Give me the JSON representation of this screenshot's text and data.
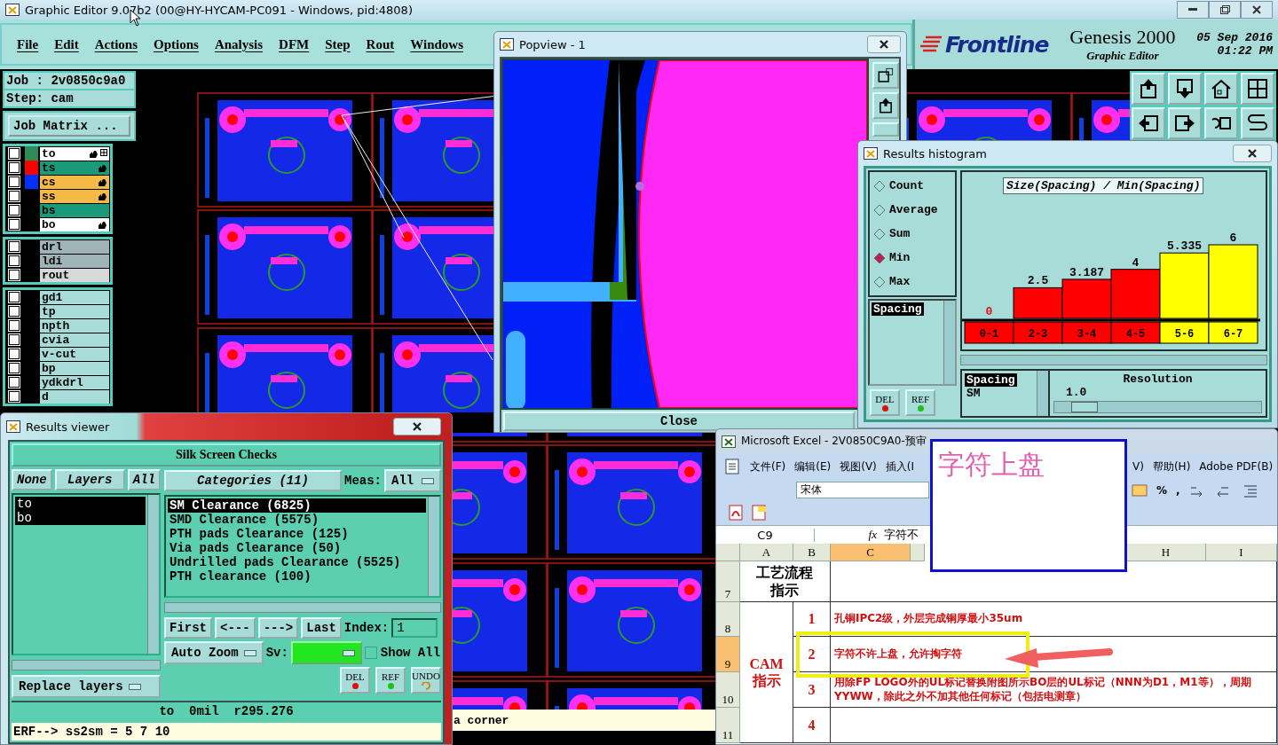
{
  "main_window": {
    "title": "Graphic Editor 9.07b2 (00@HY-HYCAM-PC091 - Windows, pid:4808)",
    "menu": [
      "File",
      "Edit",
      "Actions",
      "Options",
      "Analysis",
      "DFM",
      "Step",
      "Rout",
      "Windows"
    ],
    "brand": {
      "logo": "Frontline",
      "product": "Genesis 2000",
      "subtitle": "Graphic Editor",
      "date": "05 Sep 2016",
      "time": "01:22 PM"
    },
    "job": "Job : 2v0850c9a0",
    "step": "Step: cam",
    "job_matrix_button": "Job Matrix ...",
    "layer_groups": [
      [
        {
          "name": "to",
          "swatch": {
            "color": "#2e8b57"
          },
          "color": "#ffffff",
          "checked": false,
          "hand": true,
          "work_layer": true
        },
        {
          "name": "ts",
          "swatch": {
            "color": "#ff0000"
          },
          "color": "#1a9a78",
          "checked": false,
          "hand": true,
          "work_layer": false
        },
        {
          "name": "cs",
          "swatch": {
            "color": "#0030ff"
          },
          "color": "#f5b946",
          "checked": false,
          "hand": true,
          "work_layer": false
        },
        {
          "name": "ss",
          "color": "#f5b946",
          "checked": false,
          "hand": true,
          "work_layer": false
        },
        {
          "name": "bs",
          "color": "#1a9a78",
          "checked": false,
          "hand": false,
          "work_layer": false
        },
        {
          "name": "bo",
          "color": "#ffffff",
          "checked": false,
          "hand": true,
          "work_layer": false
        }
      ],
      [
        {
          "name": "drl",
          "color": "#9fb4b8",
          "checked": false,
          "hand": false,
          "work_layer": false
        },
        {
          "name": "ldi",
          "color": "#9fb4b8",
          "checked": false,
          "hand": false,
          "work_layer": false
        },
        {
          "name": "rout",
          "color": "#d8d8d8",
          "checked": false,
          "hand": false,
          "work_layer": false
        }
      ],
      [
        {
          "name": "gd1",
          "color": "#a8dcd8",
          "checked": false,
          "hand": false,
          "work_layer": false
        },
        {
          "name": "tp",
          "color": "#a8dcd8",
          "checked": false,
          "hand": false,
          "work_layer": false
        },
        {
          "name": "npth",
          "color": "#a8dcd8",
          "checked": false,
          "hand": false,
          "work_layer": false
        },
        {
          "name": "cvia",
          "color": "#a8dcd8",
          "checked": false,
          "hand": false,
          "work_layer": false
        },
        {
          "name": "v-cut",
          "color": "#a8dcd8",
          "checked": false,
          "hand": false,
          "work_layer": false
        },
        {
          "name": "bp",
          "color": "#a8dcd8",
          "checked": false,
          "hand": false,
          "work_layer": false
        },
        {
          "name": "ydkdrl",
          "color": "#a8dcd8",
          "checked": false,
          "hand": false,
          "work_layer": false
        },
        {
          "name": "d",
          "color": "#a8dcd8",
          "checked": false,
          "hand": false,
          "work_layer": false
        }
      ]
    ],
    "status_hint": "a corner"
  },
  "popview": {
    "title": "Popview - 1",
    "close_button": "Close"
  },
  "results_histogram": {
    "title": "Results histogram",
    "measures": [
      {
        "label": "Count",
        "selected": false
      },
      {
        "label": "Average",
        "selected": false
      },
      {
        "label": "Sum",
        "selected": false
      },
      {
        "label": "Min",
        "selected": true
      },
      {
        "label": "Max",
        "selected": false
      }
    ],
    "attributes": [
      {
        "label": "Spacing",
        "selected": true
      }
    ],
    "buttons": [
      "DEL",
      "REF"
    ],
    "chart_data": {
      "type": "bar",
      "title": "Size(Spacing) / Min(Spacing)",
      "categories": [
        "0-1",
        "2-3",
        "3-4",
        "4-5",
        "5-6",
        "6-7"
      ],
      "values": [
        0,
        2.5,
        3.187,
        4,
        5.335,
        6
      ],
      "data_labels": true
    },
    "bins": [
      {
        "color": "#ff0000"
      },
      {
        "color": "#ff0000"
      },
      {
        "color": "#ff0000"
      },
      {
        "color": "#ff0000"
      },
      {
        "color": "#ffff00"
      },
      {
        "color": "#ffff00"
      }
    ],
    "sources": [
      {
        "label": "Spacing",
        "selected": true
      },
      {
        "label": "SM",
        "selected": false
      }
    ],
    "resolution": {
      "label": "Resolution",
      "value": "1.0",
      "level": 0.08
    }
  },
  "results_viewer": {
    "title": "Results viewer",
    "header": "Silk Screen Checks",
    "layer_buttons": [
      "None",
      "Layers",
      "All"
    ],
    "layers": [
      {
        "label": "to",
        "selected": true
      },
      {
        "label": "bo",
        "selected": true
      }
    ],
    "categories_button": "Categories (11)",
    "meas_label": "Meas:",
    "meas_value": "All",
    "categories": [
      {
        "label": "SM Clearance (6825)",
        "selected": true
      },
      {
        "label": "SMD Clearance (5575)",
        "selected": false
      },
      {
        "label": "PTH pads Clearance (125)",
        "selected": false
      },
      {
        "label": "Via pads Clearance (50)",
        "selected": false
      },
      {
        "label": "Undrilled pads Clearance (5525)",
        "selected": false
      },
      {
        "label": "PTH clearance (100)",
        "selected": false
      }
    ],
    "nav_buttons": [
      "First",
      "<---",
      "--->",
      "Last"
    ],
    "index_label": "Index:",
    "index_value": "1",
    "zoom_mode": "Auto Zoom",
    "sv_label": "Sv:",
    "sv": {
      "color": "#22e622"
    },
    "show_all": {
      "label": "Show All",
      "checked": false
    },
    "replace_mode": "Replace layers",
    "action_buttons": [
      "DEL",
      "REF",
      "UNDO"
    ],
    "status": "to  0mil  r295.276",
    "command": "ERF--> ss2sm = 5 7 10"
  },
  "excel": {
    "title": "Microsoft Excel - 2V0850C9A0-预审",
    "menu": [
      "文件(F)",
      "编辑(E)",
      "视图(V)",
      "插入(I",
      "V)",
      "帮助(H)",
      "Adobe PDF(B)"
    ],
    "font": "宋体",
    "toolbar_texts": [
      "%",
      ","
    ],
    "name_box": "C9",
    "fx": "fx",
    "formula": "字符不",
    "columns": [
      {
        "label": "A",
        "selected": false
      },
      {
        "label": "B",
        "selected": false
      },
      {
        "label": "C",
        "selected": true
      },
      {
        "label": "H",
        "selected": false
      },
      {
        "label": "I",
        "selected": false
      }
    ],
    "rows": [
      {
        "label": "7",
        "selected": false
      },
      {
        "label": "8",
        "selected": false
      },
      {
        "label": "9",
        "selected": true
      },
      {
        "label": "10",
        "selected": false
      },
      {
        "label": "11",
        "selected": false
      }
    ],
    "section_header": "工艺流程指示",
    "section_label": "CAM指示",
    "items": [
      {
        "number": "1",
        "text": "孔铜IPC2级，外层完成铜厚最小35um"
      },
      {
        "number": "2",
        "text": "字符不许上盘，允许掏字符"
      },
      {
        "number": "3",
        "text": "用除FP LOGO外的UL标记替换附图所示BO层的UL标记（NNN为D1，M1等），周期YYWW，除此之外不加其他任何标记（包括电测章）"
      },
      {
        "number": "4"
      }
    ]
  },
  "note_box": {
    "text": "字符上盘"
  }
}
